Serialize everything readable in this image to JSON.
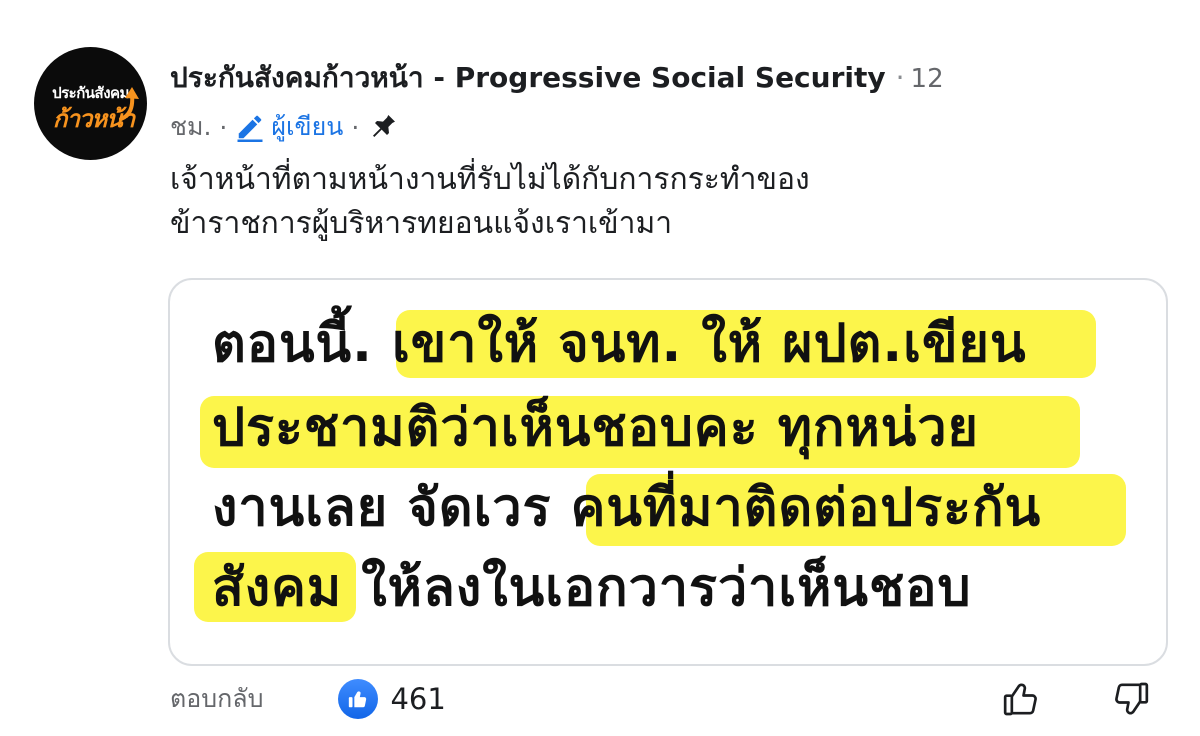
{
  "page": {
    "avatar_line1": "ประกันสังคม",
    "avatar_line2": "ก้าวหน้า",
    "name": "ประกันสังคมก้าวหน้า - Progressive Social Security",
    "time_number": "12",
    "time_unit": "ชม.",
    "author_badge": "ผู้เขียน",
    "separator": "·"
  },
  "comment": {
    "lines": [
      "เจ้าหน้าที่ตามหน้างานที่รับไม่ได้กับการกระทำของ",
      "ข้าราชการผู้บริหารทยอนแจ้งเราเข้ามา"
    ]
  },
  "attachment": {
    "lines": [
      "ตอนนี้. เขาให้ จนท. ให้ ผปต.เขียน",
      "ประชามติว่าเห็นชอบคะ ทุกหน่วย",
      "งานเลย จัดเวร คนที่มาติดต่อประกัน",
      "สังคม ให้ลงในเอกวารว่าเห็นชอบ"
    ],
    "highlight_color": "#fcf32c"
  },
  "actions": {
    "reply_label": "ตอบกลับ",
    "like_count": "461"
  },
  "colors": {
    "accent": "#1b74e4",
    "meta_gray": "#65676b",
    "brand_orange": "#f7931e"
  },
  "icons": {
    "avatar": "progressive-social-security-logo",
    "author": "pencil-icon",
    "pinned": "pin-icon",
    "like_badge": "thumbs-up-icon",
    "upvote": "thumbs-up-outline-icon",
    "downvote": "thumbs-down-outline-icon"
  }
}
